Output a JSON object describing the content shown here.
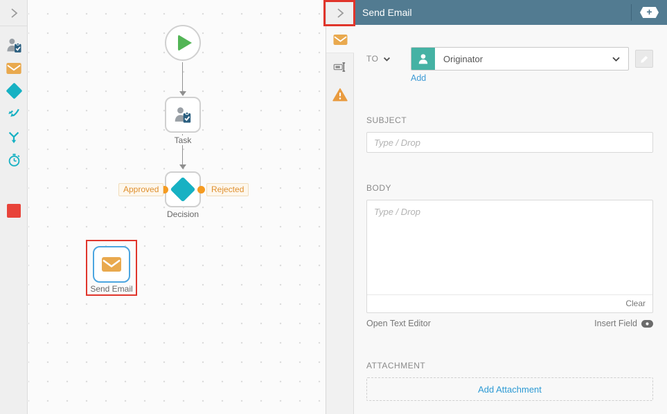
{
  "colors": {
    "header_bar": "#527b91",
    "accent_teal": "#17b1c3",
    "envelope_orange": "#e9a94e",
    "branch_orange": "#f59b20",
    "selection_blue": "#4ba5e0",
    "annotation_red": "#e0352b",
    "person_teal": "#45b2a4",
    "link_blue": "#3d9ad5"
  },
  "toolbar": {
    "tools": [
      {
        "icon": "user-task-icon"
      },
      {
        "icon": "envelope-icon"
      },
      {
        "icon": "decision-diamond-icon"
      },
      {
        "icon": "merge-arrows-icon"
      },
      {
        "icon": "split-arrows-icon"
      },
      {
        "icon": "timer-icon"
      },
      {
        "icon": "end-stop-icon"
      }
    ]
  },
  "canvas": {
    "nodes": {
      "start": {
        "type": "start"
      },
      "task": {
        "label": "Task"
      },
      "decision": {
        "label": "Decision",
        "left_branch": "Approved",
        "right_branch": "Rejected"
      },
      "send_email": {
        "label": "Send Email",
        "selected": true
      }
    }
  },
  "panel": {
    "title": "Send Email",
    "add_button": "+",
    "tabs": [
      {
        "icon": "envelope-icon",
        "active": true
      },
      {
        "icon": "rename-icon",
        "active": false
      },
      {
        "icon": "warning-icon",
        "active": false
      }
    ],
    "fields": {
      "to": {
        "label": "TO",
        "value": "Originator",
        "add_link": "Add"
      },
      "subject": {
        "label": "SUBJECT",
        "placeholder": "Type / Drop"
      },
      "body": {
        "label": "BODY",
        "placeholder": "Type / Drop",
        "clear": "Clear",
        "open_text_editor": "Open Text Editor",
        "insert_field": "Insert Field"
      },
      "attachment": {
        "label": "ATTACHMENT",
        "add_button": "Add Attachment"
      }
    }
  }
}
